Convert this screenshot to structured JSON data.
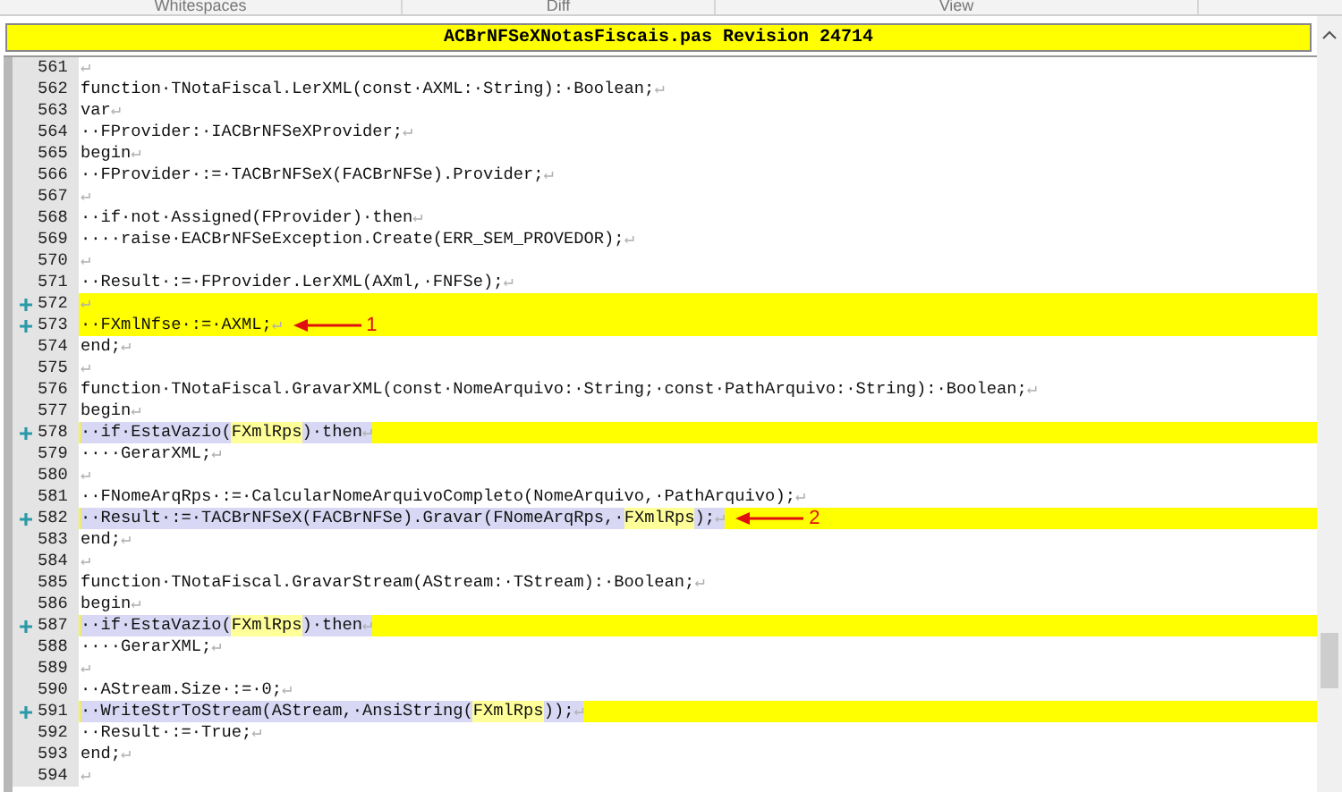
{
  "toolbar": {
    "groups": [
      "Whitespaces",
      "Diff",
      "View"
    ]
  },
  "title": "ACBrNFSeXNotasFiscais.pas Revision 24714",
  "lines": [
    {
      "number": "561",
      "kind": "plain",
      "eol": "↵"
    },
    {
      "number": "562",
      "kind": "plain",
      "segments": [
        {
          "text": "function·TNotaFiscal.LerXML(const·AXML:·String):·Boolean;"
        }
      ],
      "eol": "↵"
    },
    {
      "number": "563",
      "kind": "plain",
      "segments": [
        {
          "text": "var"
        }
      ],
      "eol": "↵"
    },
    {
      "number": "564",
      "kind": "plain",
      "segments": [
        {
          "text": "··FProvider:·IACBrNFSeXProvider;"
        }
      ],
      "eol": "↵"
    },
    {
      "number": "565",
      "kind": "plain",
      "segments": [
        {
          "text": "begin"
        }
      ],
      "eol": "↵"
    },
    {
      "number": "566",
      "kind": "plain",
      "segments": [
        {
          "text": "··FProvider·:=·TACBrNFSeX(FACBrNFSe).Provider;"
        }
      ],
      "eol": "↵"
    },
    {
      "number": "567",
      "kind": "plain",
      "eol": "↵"
    },
    {
      "number": "568",
      "kind": "plain",
      "segments": [
        {
          "text": "··if·not·Assigned(FProvider)·then"
        }
      ],
      "eol": "↵"
    },
    {
      "number": "569",
      "kind": "plain",
      "segments": [
        {
          "text": "····raise·EACBrNFSeException.Create(ERR_SEM_PROVEDOR);"
        }
      ],
      "eol": "↵"
    },
    {
      "number": "570",
      "kind": "plain",
      "eol": "↵"
    },
    {
      "number": "571",
      "kind": "plain",
      "segments": [
        {
          "text": "··Result·:=·FProvider.LerXML(AXml,·FNFSe);"
        }
      ],
      "eol": "↵"
    },
    {
      "number": "572",
      "kind": "added",
      "eol": "↵"
    },
    {
      "number": "573",
      "kind": "added",
      "segments": [
        {
          "text": "··FXmlNfse·:=·AXML;"
        }
      ],
      "eol": "↵",
      "annotation": "1"
    },
    {
      "number": "574",
      "kind": "plain",
      "segments": [
        {
          "text": "end;"
        }
      ],
      "eol": "↵"
    },
    {
      "number": "575",
      "kind": "plain",
      "eol": "↵"
    },
    {
      "number": "576",
      "kind": "plain",
      "segments": [
        {
          "text": "function·TNotaFiscal.GravarXML(const·NomeArquivo:·String;·const·PathArquivo:·String):·Boolean;"
        }
      ],
      "eol": "↵"
    },
    {
      "number": "577",
      "kind": "plain",
      "segments": [
        {
          "text": "begin"
        }
      ],
      "eol": "↵"
    },
    {
      "number": "578",
      "kind": "modified",
      "segments": [
        {
          "text": "··if·EstaVazio(",
          "highlight": false
        },
        {
          "text": "FXmlRps",
          "highlight": true
        },
        {
          "text": ")·then",
          "highlight": false
        }
      ],
      "eol": "↵"
    },
    {
      "number": "579",
      "kind": "plain",
      "segments": [
        {
          "text": "····GerarXML;"
        }
      ],
      "eol": "↵"
    },
    {
      "number": "580",
      "kind": "plain",
      "eol": "↵"
    },
    {
      "number": "581",
      "kind": "plain",
      "segments": [
        {
          "text": "··FNomeArqRps·:=·CalcularNomeArquivoCompleto(NomeArquivo,·PathArquivo);"
        }
      ],
      "eol": "↵"
    },
    {
      "number": "582",
      "kind": "modified",
      "segments": [
        {
          "text": "··Result·:=·TACBrNFSeX(FACBrNFSe).Gravar(FNomeArqRps,·",
          "highlight": false
        },
        {
          "text": "FXmlRps",
          "highlight": true
        },
        {
          "text": ");",
          "highlight": false
        }
      ],
      "eol": "↵",
      "annotation": "2"
    },
    {
      "number": "583",
      "kind": "plain",
      "segments": [
        {
          "text": "end;"
        }
      ],
      "eol": "↵"
    },
    {
      "number": "584",
      "kind": "plain",
      "eol": "↵"
    },
    {
      "number": "585",
      "kind": "plain",
      "segments": [
        {
          "text": "function·TNotaFiscal.GravarStream(AStream:·TStream):·Boolean;"
        }
      ],
      "eol": "↵"
    },
    {
      "number": "586",
      "kind": "plain",
      "segments": [
        {
          "text": "begin"
        }
      ],
      "eol": "↵"
    },
    {
      "number": "587",
      "kind": "modified",
      "segments": [
        {
          "text": "··if·EstaVazio(",
          "highlight": false
        },
        {
          "text": "FXmlRps",
          "highlight": true
        },
        {
          "text": ")·then",
          "highlight": false
        }
      ],
      "eol": "↵"
    },
    {
      "number": "588",
      "kind": "plain",
      "segments": [
        {
          "text": "····GerarXML;"
        }
      ],
      "eol": "↵"
    },
    {
      "number": "589",
      "kind": "plain",
      "eol": "↵"
    },
    {
      "number": "590",
      "kind": "plain",
      "segments": [
        {
          "text": "··AStream.Size·:=·0;"
        }
      ],
      "eol": "↵"
    },
    {
      "number": "591",
      "kind": "modified",
      "segments": [
        {
          "text": "··WriteStrToStream(AStream,·AnsiString(",
          "highlight": false
        },
        {
          "text": "FXmlRps",
          "highlight": true
        },
        {
          "text": "));",
          "highlight": false
        }
      ],
      "eol": "↵"
    },
    {
      "number": "592",
      "kind": "plain",
      "segments": [
        {
          "text": "··Result·:=·True;"
        }
      ],
      "eol": "↵"
    },
    {
      "number": "593",
      "kind": "plain",
      "segments": [
        {
          "text": "end;"
        }
      ],
      "eol": "↵"
    },
    {
      "number": "594",
      "kind": "plain",
      "eol": "↵"
    }
  ]
}
